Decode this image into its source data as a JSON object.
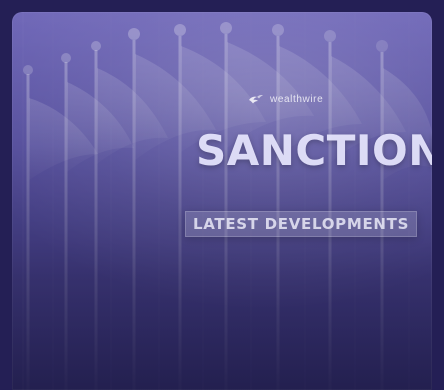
{
  "brand": {
    "logo_icon": "bird-logo-icon",
    "text": "wealthwire"
  },
  "hero": {
    "title": "SANCTIONS",
    "subtitle": "LATEST DEVELOPMENTS"
  },
  "colors": {
    "background": "#241f55",
    "card_top": "#6f67b8",
    "card_bottom": "#2f2a6a",
    "title": "#e8e7ff"
  }
}
